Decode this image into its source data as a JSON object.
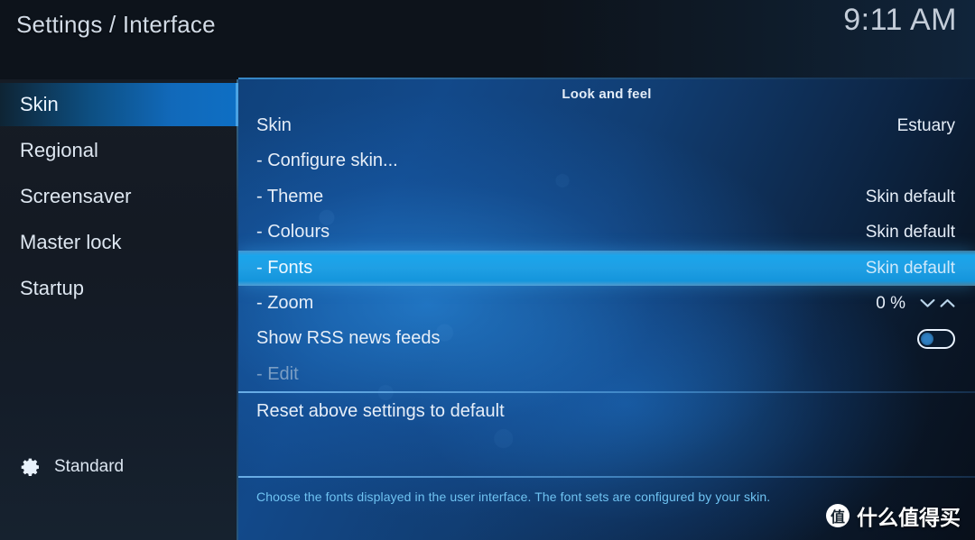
{
  "header": {
    "title": "Settings / Interface",
    "clock": "9:11 AM"
  },
  "sidebar": {
    "items": [
      {
        "label": "Skin",
        "selected": true
      },
      {
        "label": "Regional",
        "selected": false
      },
      {
        "label": "Screensaver",
        "selected": false
      },
      {
        "label": "Master lock",
        "selected": false
      },
      {
        "label": "Startup",
        "selected": false
      }
    ],
    "profile": {
      "icon": "gear-icon",
      "label": "Standard"
    }
  },
  "main": {
    "section_header": "Look and feel",
    "rows": [
      {
        "label": "Skin",
        "value": "Estuary",
        "state": "normal",
        "control": "none"
      },
      {
        "label": "- Configure skin...",
        "value": "",
        "state": "normal",
        "control": "none"
      },
      {
        "label": "- Theme",
        "value": "Skin default",
        "state": "normal",
        "control": "none"
      },
      {
        "label": "- Colours",
        "value": "Skin default",
        "state": "normal",
        "control": "none"
      },
      {
        "label": "- Fonts",
        "value": "Skin default",
        "state": "highlight",
        "control": "none"
      },
      {
        "label": "- Zoom",
        "value": "0 %",
        "state": "normal",
        "control": "spinner"
      },
      {
        "label": "Show RSS news feeds",
        "value": "",
        "state": "normal",
        "control": "toggle"
      },
      {
        "label": "- Edit",
        "value": "",
        "state": "dim",
        "control": "none"
      },
      {
        "label": "Reset above settings to default",
        "value": "",
        "state": "normal",
        "control": "none"
      }
    ],
    "toggle_rss_on": false,
    "help_text": "Choose the fonts displayed in the user interface. The font sets are configured by your skin."
  },
  "watermark": {
    "badge": "值",
    "text": "什么值得买"
  },
  "colors": {
    "accent_highlight": "#1fa0e5",
    "sidebar_selected": "#0e6fc4",
    "help_text": "#6fc3f2",
    "text_primary": "#e6eef8",
    "text_dim": "#7b9ec4"
  }
}
